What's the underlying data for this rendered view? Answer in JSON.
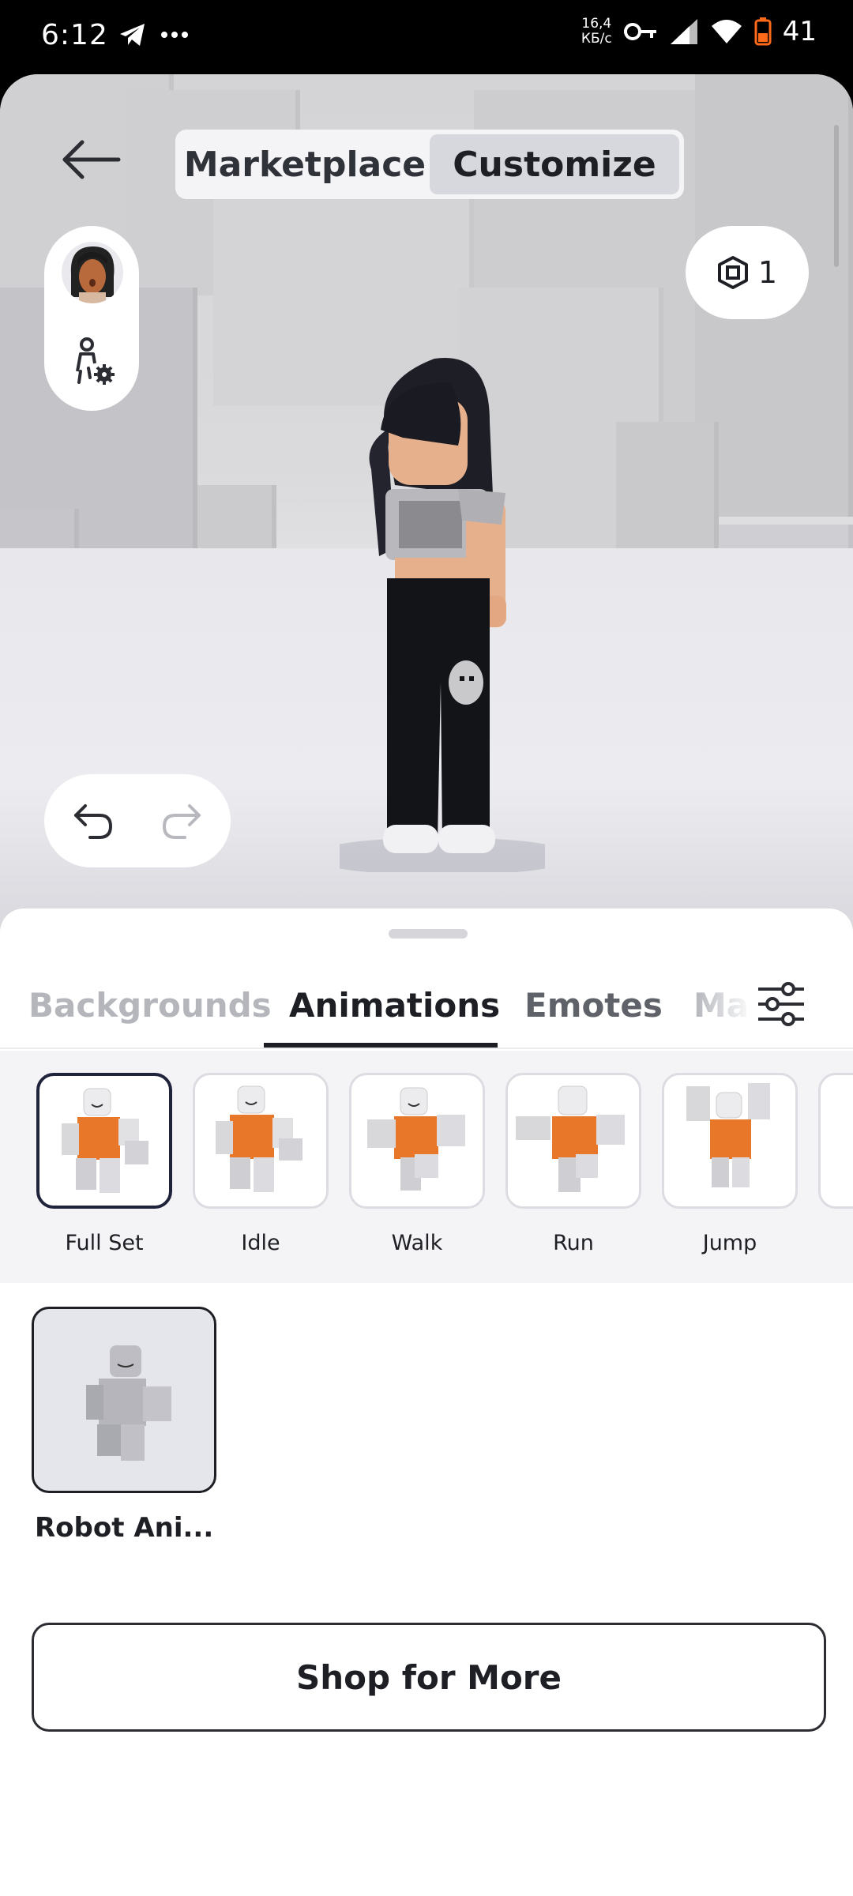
{
  "status_bar": {
    "time": "6:12",
    "net_speed_value": "16,4",
    "net_speed_unit": "КБ/с",
    "battery": "41",
    "icons": [
      "telegram-icon",
      "more-dots-icon",
      "vpn-key-icon",
      "cell-signal-icon",
      "wifi-icon",
      "battery-icon"
    ]
  },
  "header": {
    "segments": [
      {
        "label": "Marketplace",
        "active": false
      },
      {
        "label": "Customize",
        "active": true
      }
    ]
  },
  "robux": {
    "count": "1"
  },
  "tabs": [
    {
      "label": "Backgrounds",
      "state": "faded"
    },
    {
      "label": "Animations",
      "state": "active"
    },
    {
      "label": "Emotes",
      "state": "normal"
    },
    {
      "label": "Ma",
      "state": "faded"
    }
  ],
  "animation_types": [
    {
      "label": "Full Set",
      "selected": true
    },
    {
      "label": "Idle",
      "selected": false
    },
    {
      "label": "Walk",
      "selected": false
    },
    {
      "label": "Run",
      "selected": false
    },
    {
      "label": "Jump",
      "selected": false
    }
  ],
  "items": [
    {
      "name": "Robot Ani..."
    }
  ],
  "shop_button": {
    "label": "Shop for More"
  },
  "colors": {
    "accent_dark": "#1d1f24",
    "robot_torso": "#e8772a",
    "sheet_bg": "#ffffff",
    "strip_bg": "#f4f4f6"
  }
}
